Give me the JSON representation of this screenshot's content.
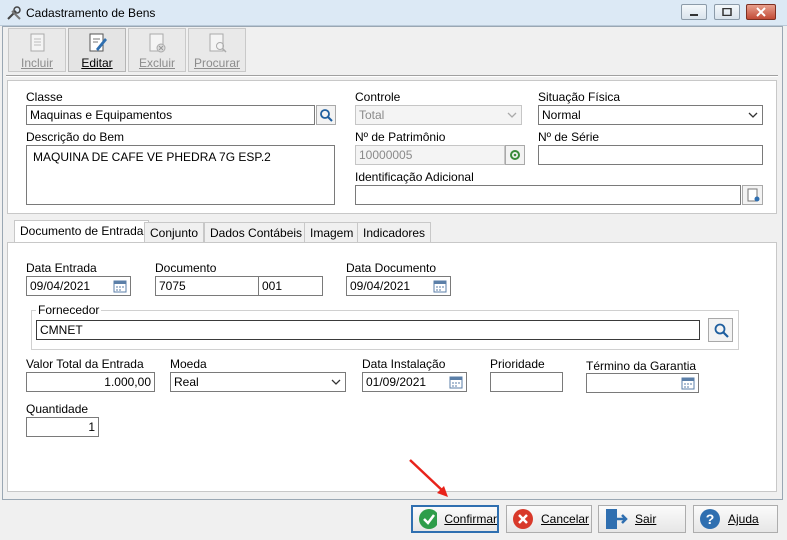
{
  "window": {
    "title": "Cadastramento de Bens"
  },
  "toolbar": {
    "incluir": "Incluir",
    "editar": "Editar",
    "excluir": "Excluir",
    "procurar": "Procurar"
  },
  "form": {
    "classe": {
      "label": "Classe",
      "value": "Maquinas e Equipamentos"
    },
    "controle": {
      "label": "Controle",
      "value": "Total"
    },
    "situacao": {
      "label": "Situação Física",
      "value": "Normal"
    },
    "descricao": {
      "label": "Descrição do Bem",
      "value": "MAQUINA DE CAFE VE PHEDRA 7G ESP.2"
    },
    "patrimonio": {
      "label": "Nº de Patrimônio",
      "value": "10000005"
    },
    "serie": {
      "label": "Nº de Série",
      "value": ""
    },
    "identificacao": {
      "label": "Identificação Adicional",
      "value": ""
    }
  },
  "tabs": [
    "Documento de Entrada",
    "Conjunto",
    "Dados Contábeis",
    "Imagem",
    "Indicadores"
  ],
  "entrada": {
    "data_entrada": {
      "label": "Data Entrada",
      "value": "09/04/2021"
    },
    "documento": {
      "label": "Documento",
      "value": "7075",
      "serie": "001"
    },
    "data_documento": {
      "label": "Data Documento",
      "value": "09/04/2021"
    },
    "fornecedor": {
      "label": "Fornecedor",
      "value": "CMNET"
    },
    "valor_total": {
      "label": "Valor Total da Entrada",
      "value": "1.000,00"
    },
    "moeda": {
      "label": "Moeda",
      "value": "Real"
    },
    "data_instalacao": {
      "label": "Data Instalação",
      "value": "01/09/2021"
    },
    "prioridade": {
      "label": "Prioridade",
      "value": ""
    },
    "termino_garantia": {
      "label": "Término da Garantia",
      "value": ""
    },
    "quantidade": {
      "label": "Quantidade",
      "value": "1"
    }
  },
  "buttons": {
    "confirmar": "Confirmar",
    "cancelar": "Cancelar",
    "sair": "Sair",
    "ajuda": "Ajuda"
  },
  "colors": {
    "arrow": "#e8231b",
    "focus": "#2f6fb0",
    "titlebar": "#dce9f5"
  }
}
